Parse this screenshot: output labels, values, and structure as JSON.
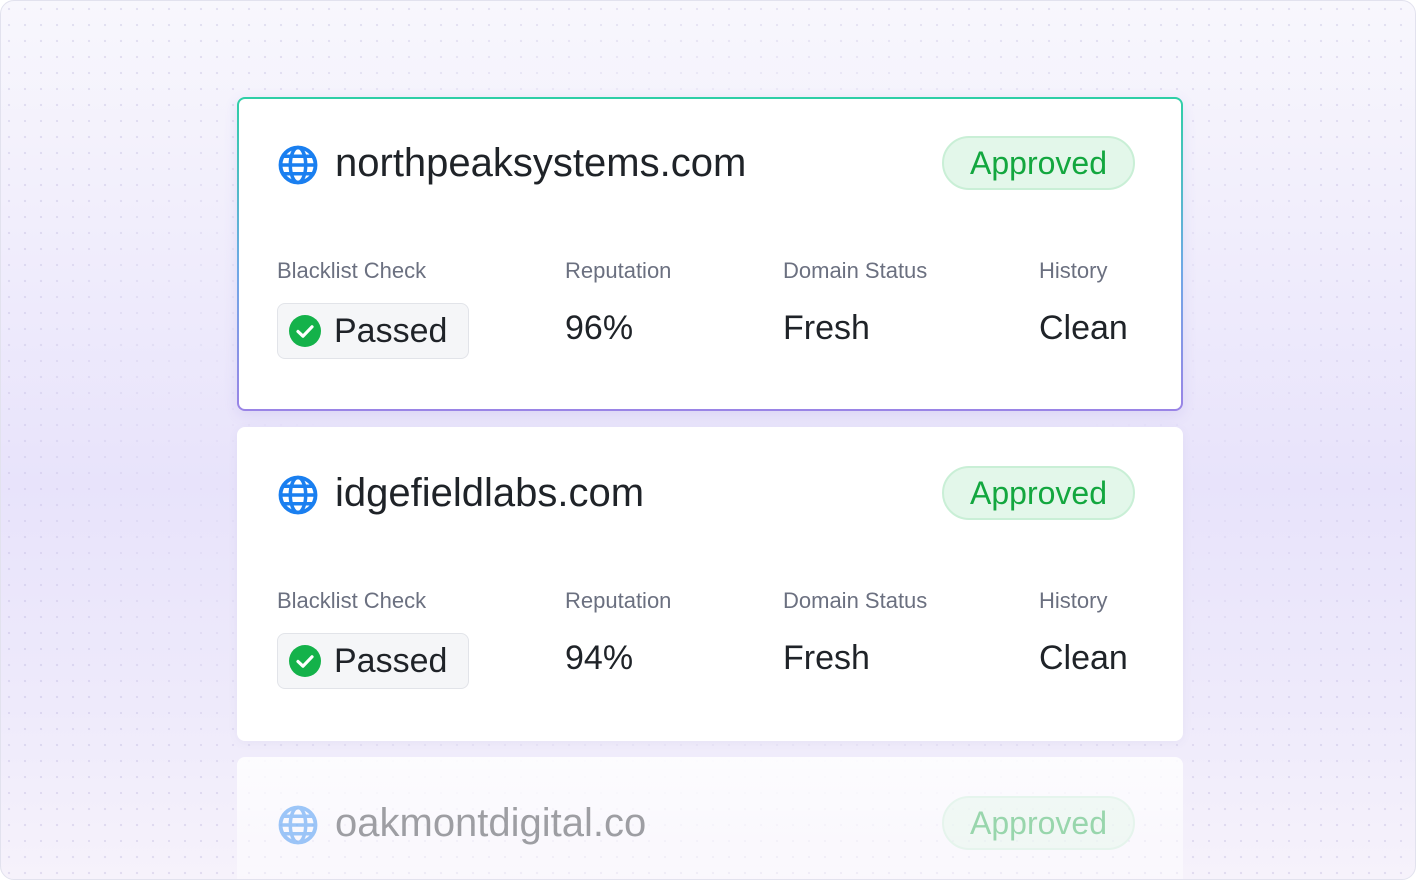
{
  "cards": [
    {
      "domain": "northpeaksystems.com",
      "badge": "Approved",
      "metrics": {
        "blacklist_label": "Blacklist Check",
        "blacklist_value": "Passed",
        "reputation_label": "Reputation",
        "reputation_value": "96%",
        "status_label": "Domain Status",
        "status_value": "Fresh",
        "history_label": "History",
        "history_value": "Clean"
      }
    },
    {
      "domain": "idgefieldlabs.com",
      "badge": "Approved",
      "metrics": {
        "blacklist_label": "Blacklist Check",
        "blacklist_value": "Passed",
        "reputation_label": "Reputation",
        "reputation_value": "94%",
        "status_label": "Domain Status",
        "status_value": "Fresh",
        "history_label": "History",
        "history_value": "Clean"
      }
    },
    {
      "domain": "oakmontdigital.co",
      "badge": "Approved"
    }
  ],
  "icons": {
    "domain": "globe-icon",
    "passed": "check-circle-icon"
  },
  "colors": {
    "globe": "#1a7ff0",
    "approved_text": "#13a73f",
    "approved_bg": "#e3f7ea",
    "check": "#14b24a",
    "active_border_top": "#2fcfa6",
    "active_border_bottom": "#9a84e6"
  }
}
